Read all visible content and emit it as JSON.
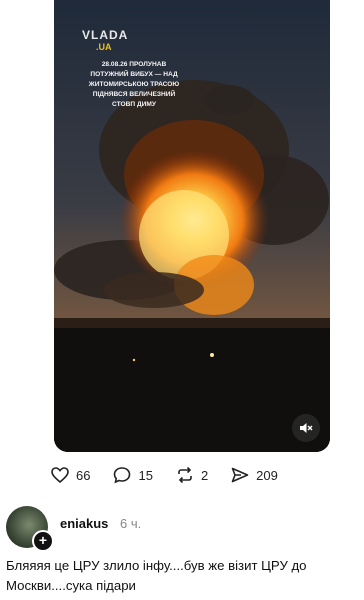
{
  "post": {
    "brand": "VLADA",
    "brand_sub": ".UA",
    "caption": "28.08.26 ПРОЛУНАВ ПОТУЖНИЙ ВИБУХ — НАД ЖИТОМИРСЬКОЮ ТРАСОЮ ПІДНЯВСЯ ВЕЛИЧЕЗНИЙ СТОВП ДИМУ",
    "actions": {
      "likes": "66",
      "comments": "15",
      "reposts": "2",
      "shares": "209"
    }
  },
  "comment": {
    "username": "eniakus",
    "time": "6 ч.",
    "text": "Бляяяя це ЦРУ злило інфу....був же візит ЦРУ до Москви....сука підари"
  },
  "icons": {
    "like": "heart-icon",
    "comment": "speech-bubble-icon",
    "repost": "repost-icon",
    "share": "send-icon",
    "mute": "muted-speaker-icon",
    "follow": "plus-icon"
  }
}
